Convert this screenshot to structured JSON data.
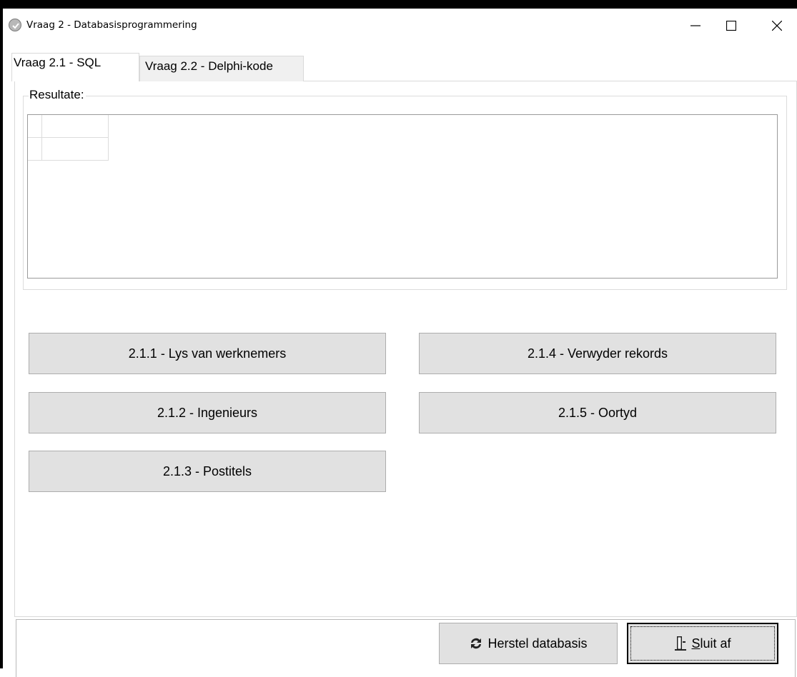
{
  "window": {
    "title": "Vraag 2 - Databasisprogrammering",
    "controls": [
      "minimize",
      "maximize",
      "close"
    ]
  },
  "tabs": [
    {
      "label": "Vraag 2.1 - SQL",
      "active": true
    },
    {
      "label": "Vraag 2.2 - Delphi-kode",
      "active": false
    }
  ],
  "results": {
    "label": "Resultate:",
    "grid_rows": [
      [
        ""
      ],
      [
        ""
      ]
    ]
  },
  "buttons": {
    "b211": "2.1.1 - Lys van werknemers",
    "b212": "2.1.2 - Ingenieurs",
    "b213": "2.1.3 - Postitels",
    "b214": "2.1.4 - Verwyder rekords",
    "b215": "2.1.5 - Oortyd"
  },
  "footer": {
    "herstel_label": "Herstel databasis",
    "herstel_icon": "refresh-icon",
    "sluit_hotkey": "S",
    "sluit_rest": "luit af",
    "sluit_icon": "exit-door-icon"
  }
}
